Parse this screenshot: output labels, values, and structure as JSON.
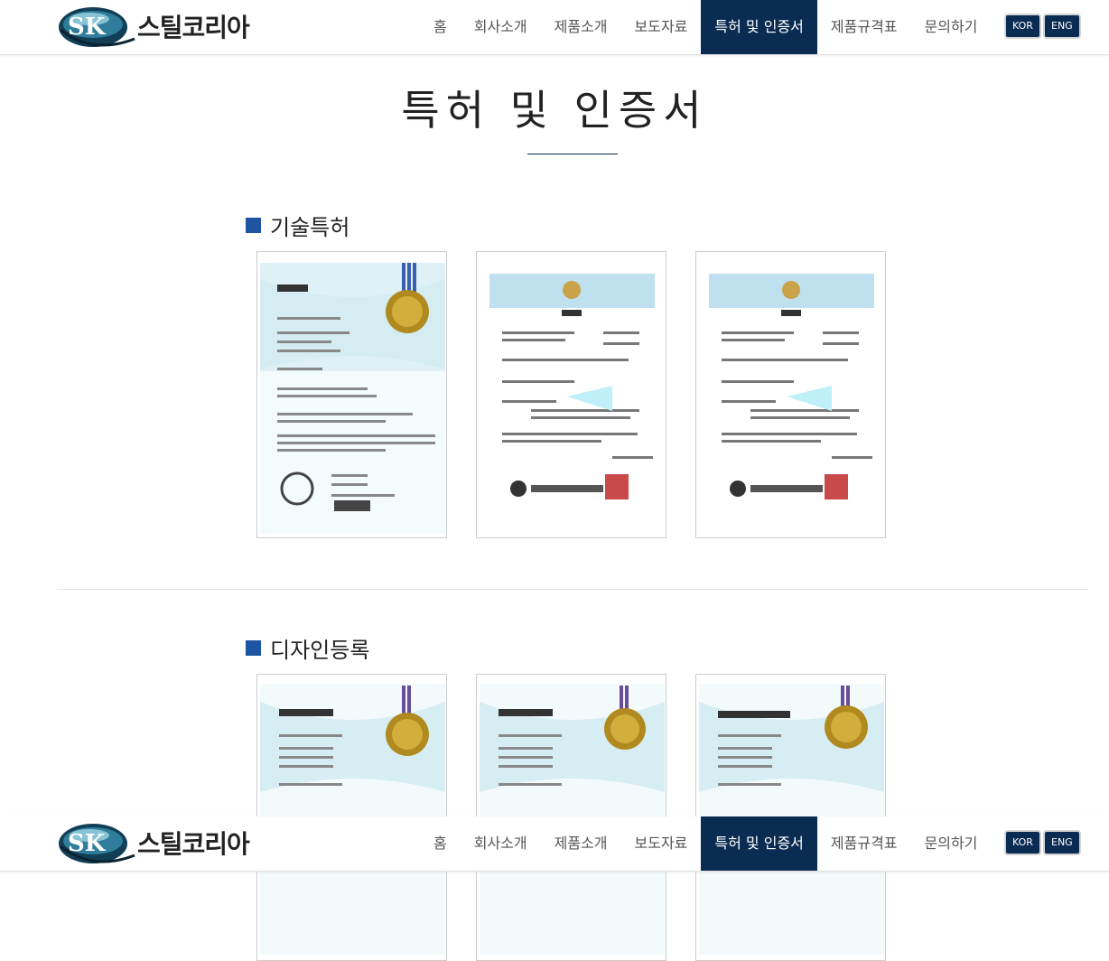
{
  "header": {
    "logo_text": "스틸코리아",
    "logo_mark_text": "SK",
    "menu": [
      {
        "label": "홈"
      },
      {
        "label": "회사소개"
      },
      {
        "label": "제품소개"
      },
      {
        "label": "보도자료"
      },
      {
        "label": "특허 및 인증서",
        "active": true
      },
      {
        "label": "제품규격표"
      },
      {
        "label": "문의하기"
      }
    ],
    "lang": {
      "kor": "KOR",
      "eng": "ENG"
    }
  },
  "page": {
    "title": "특허 및 인증서"
  },
  "sections": [
    {
      "heading": "기술특허"
    },
    {
      "heading": "디자인등록"
    }
  ],
  "colors": {
    "navy": "#0b2c52",
    "accent_square": "#1e55a3"
  },
  "icons": {
    "logo": "sk-globe-logo-icon"
  }
}
